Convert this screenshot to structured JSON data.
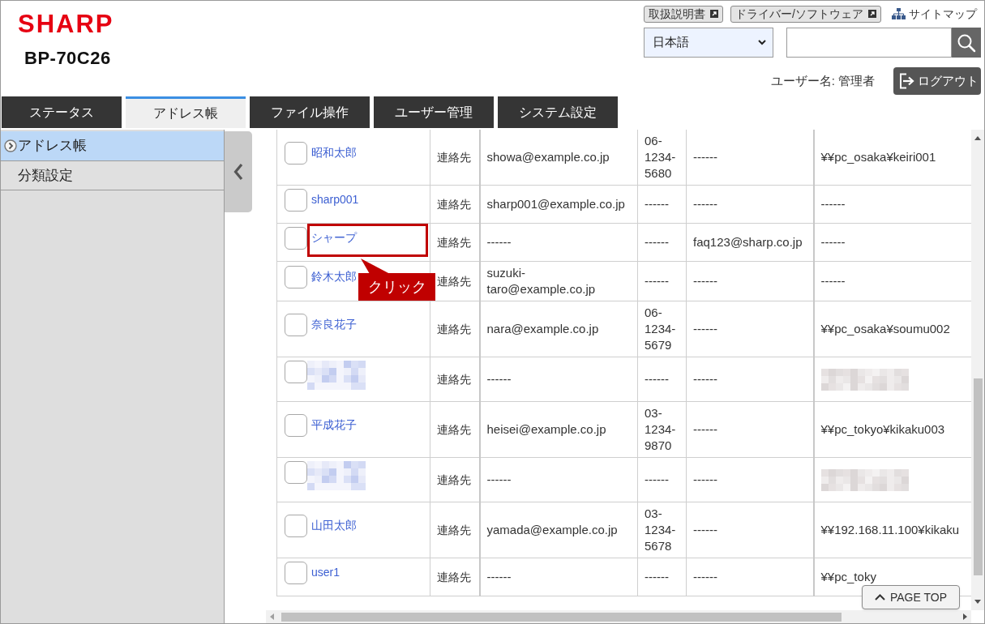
{
  "header": {
    "logo": "SHARP",
    "model": "BP-70C26",
    "links": [
      {
        "label": "取扱説明書",
        "kind": "external"
      },
      {
        "label": "ドライバー/ソフトウェア",
        "kind": "external"
      },
      {
        "label": "サイトマップ",
        "kind": "sitemap"
      }
    ],
    "language": {
      "value": "日本語"
    },
    "user": "ユーザー名: 管理者",
    "logout": "ログアウト"
  },
  "tabs": [
    {
      "label": "ステータス",
      "selected": false
    },
    {
      "label": "アドレス帳",
      "selected": true
    },
    {
      "label": "ファイル操作",
      "selected": false
    },
    {
      "label": "ユーザー管理",
      "selected": false
    },
    {
      "label": "システム設定",
      "selected": false
    }
  ],
  "sidebar": {
    "items": [
      {
        "label": "アドレス帳",
        "selected": true
      },
      {
        "label": "分類設定",
        "selected": false
      }
    ]
  },
  "table": {
    "rows": [
      {
        "checked": false,
        "highlighted": false,
        "name": "昭和太郎",
        "cells": [
          "連絡先",
          "showa@example.co.jp",
          "06-1234-5680",
          "------",
          "¥¥pc_osaka¥keiri001"
        ]
      },
      {
        "checked": false,
        "highlighted": false,
        "name": "sharp001",
        "cells": [
          "連絡先",
          "sharp001@example.co.jp",
          "------",
          "------",
          "------"
        ]
      },
      {
        "checked": false,
        "highlighted": true,
        "name": "シャープ",
        "cells": [
          "連絡先",
          "------",
          "------",
          "faq123@sharp.co.jp",
          "------"
        ]
      },
      {
        "checked": false,
        "highlighted": false,
        "name": "鈴木太郎",
        "cells": [
          "連絡先",
          "suzuki-taro@example.co.jp",
          "------",
          "------",
          "------"
        ]
      },
      {
        "checked": false,
        "highlighted": false,
        "name": "奈良花子",
        "cells": [
          "連絡先",
          "nara@example.co.jp",
          "06-1234-5679",
          "------",
          "¥¥pc_osaka¥soumu002"
        ]
      },
      {
        "checked": false,
        "highlighted": false,
        "name": {
          "kind": "redacted"
        },
        "cells": [
          "連絡先",
          "------",
          "------",
          "------",
          {
            "kind": "redacted"
          }
        ]
      },
      {
        "checked": false,
        "highlighted": false,
        "name": "平成花子",
        "cells": [
          "連絡先",
          "heisei@example.co.jp",
          "03-1234-9870",
          "------",
          "¥¥pc_tokyo¥kikaku003"
        ]
      },
      {
        "checked": false,
        "highlighted": false,
        "name": {
          "kind": "redacted"
        },
        "cells": [
          "連絡先",
          "------",
          "------",
          "------",
          {
            "kind": "redacted"
          }
        ]
      },
      {
        "checked": false,
        "highlighted": false,
        "name": "山田太郎",
        "cells": [
          "連絡先",
          "yamada@example.co.jp",
          "03-1234-5678",
          "------",
          "¥¥192.168.11.100¥kikaku"
        ]
      },
      {
        "checked": false,
        "highlighted": false,
        "name": "user1",
        "cells": [
          "連絡先",
          "------",
          "------",
          "------",
          "¥¥pc_toky"
        ]
      }
    ]
  },
  "annotation": {
    "text": "クリック"
  },
  "page_top": "PAGE TOP"
}
